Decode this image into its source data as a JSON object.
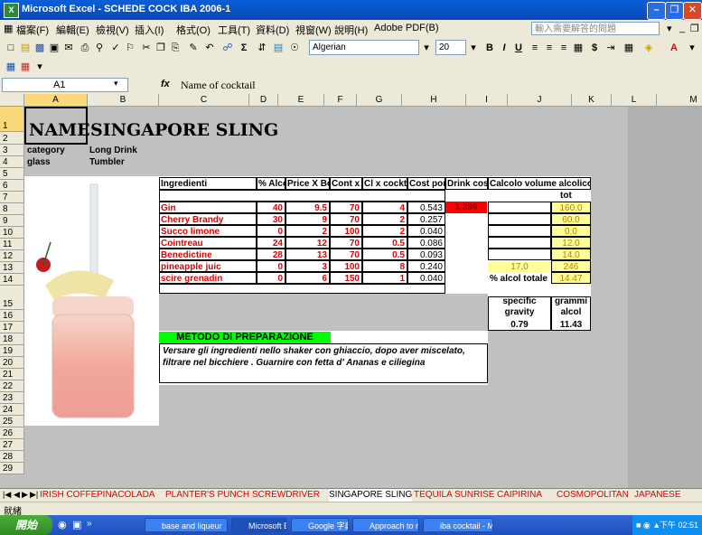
{
  "window": {
    "title": "Microsoft Excel - SCHEDE COCK IBA 2006-1"
  },
  "menu": [
    "檔案(F)",
    "編輯(E)",
    "檢視(V)",
    "插入(I)",
    "格式(O)",
    "工具(T)",
    "資料(D)",
    "視窗(W)",
    "說明(H)",
    "Adobe PDF(B)"
  ],
  "help_placeholder": "輸入需要解答的問題",
  "toolbar": {
    "font_name": "Algerian",
    "font_size": "20"
  },
  "formula_bar": {
    "cell_ref": "A1",
    "fx": "fx",
    "content": "Name of cocktail"
  },
  "columns": [
    "A",
    "B",
    "C",
    "D",
    "E",
    "F",
    "G",
    "H",
    "I",
    "J",
    "K",
    "L",
    "M"
  ],
  "rows": [
    "1",
    "2",
    "3",
    "4",
    "5",
    "6",
    "7",
    "8",
    "9",
    "10",
    "11",
    "12",
    "13",
    "14",
    "15",
    "16",
    "17",
    "18",
    "19",
    "20",
    "21",
    "22",
    "23",
    "24",
    "25",
    "26",
    "27",
    "28",
    "29"
  ],
  "sheet": {
    "name_label": "NAME",
    "cocktail_name": "SINGAPORE SLING",
    "category_label": "category",
    "category_value": "Long Drink",
    "glass_label": "glass",
    "glass_value": "Tumbler",
    "headers": [
      "Ingredienti",
      "% Alcol",
      "Price X Bot",
      "Cont x bt",
      "Cl x cockt",
      "Cost porzione",
      "Drink cost",
      "Calcolo volume alcolico"
    ],
    "tot_label": "tot",
    "ingredients": [
      {
        "name": "Gin",
        "alcol": "40",
        "price": "9.5",
        "cont": "70",
        "cl": "4",
        "cost": "0.543",
        "vol": "160.0"
      },
      {
        "name": "Cherry Brandy",
        "alcol": "30",
        "price": "9",
        "cont": "70",
        "cl": "2",
        "cost": "0.257",
        "vol": "60.0"
      },
      {
        "name": "Succo limone",
        "alcol": "0",
        "price": "2",
        "cont": "100",
        "cl": "2",
        "cost": "0.040",
        "vol": "0.0"
      },
      {
        "name": "Cointreau",
        "alcol": "24",
        "price": "12",
        "cont": "70",
        "cl": "0.5",
        "cost": "0.086",
        "vol": "12.0"
      },
      {
        "name": "Benedictine",
        "alcol": "28",
        "price": "13",
        "cont": "70",
        "cl": "0.5",
        "cost": "0.093",
        "vol": "14.0"
      },
      {
        "name": "pineapple juic",
        "alcol": "0",
        "price": "3",
        "cont": "100",
        "cl": "8",
        "cost": "0.240",
        "vol": "246"
      },
      {
        "name": "scire grenadin",
        "alcol": "0",
        "price": "6",
        "cont": "150",
        "cl": "1",
        "cost": "0.040",
        "vol": "14.47"
      }
    ],
    "drink_cost": "1.299",
    "volume_total_left": "17.0",
    "alcol_totale_label": "% alcol totale",
    "specific_gravity_label": "specific gravity",
    "specific_gravity_value": "0.79",
    "grammi_label": "grammi alcol",
    "grammi_value": "11.43",
    "method_title": "METODO DI PREPARAZIONE",
    "method_text_1": "Versare gli ingredienti nello shaker con ghiaccio, dopo aver miscelato,",
    "method_text_2": "filtrare nel bicchiere . Guarnire con fetta d' Ananas e ciliegina"
  },
  "tabs": [
    "IRISH COFFE",
    "PINACOLADA",
    "PLANTER'S PUNCH",
    "SCREWDRIVER",
    "SINGAPORE SLING",
    "TEQUILA SUNRISE",
    "CAIPIRINA",
    "COSMOPOLITAN",
    "JAPANESE"
  ],
  "active_tab": "SINGAPORE SLING",
  "status": "就緒",
  "taskbar": {
    "start": "開始",
    "tasks": [
      "base and liqueur",
      "Microsoft Excel...",
      "Google 字典: C...",
      "Approach to ma...",
      "iba cocktail - Mi..."
    ],
    "clock": "下午 02:51"
  },
  "colors": {
    "accent_red": "#e00000",
    "method_green": "#00ff00",
    "yellow_fill": "#ffff99",
    "drink_cost_fill": "#ff0000"
  }
}
